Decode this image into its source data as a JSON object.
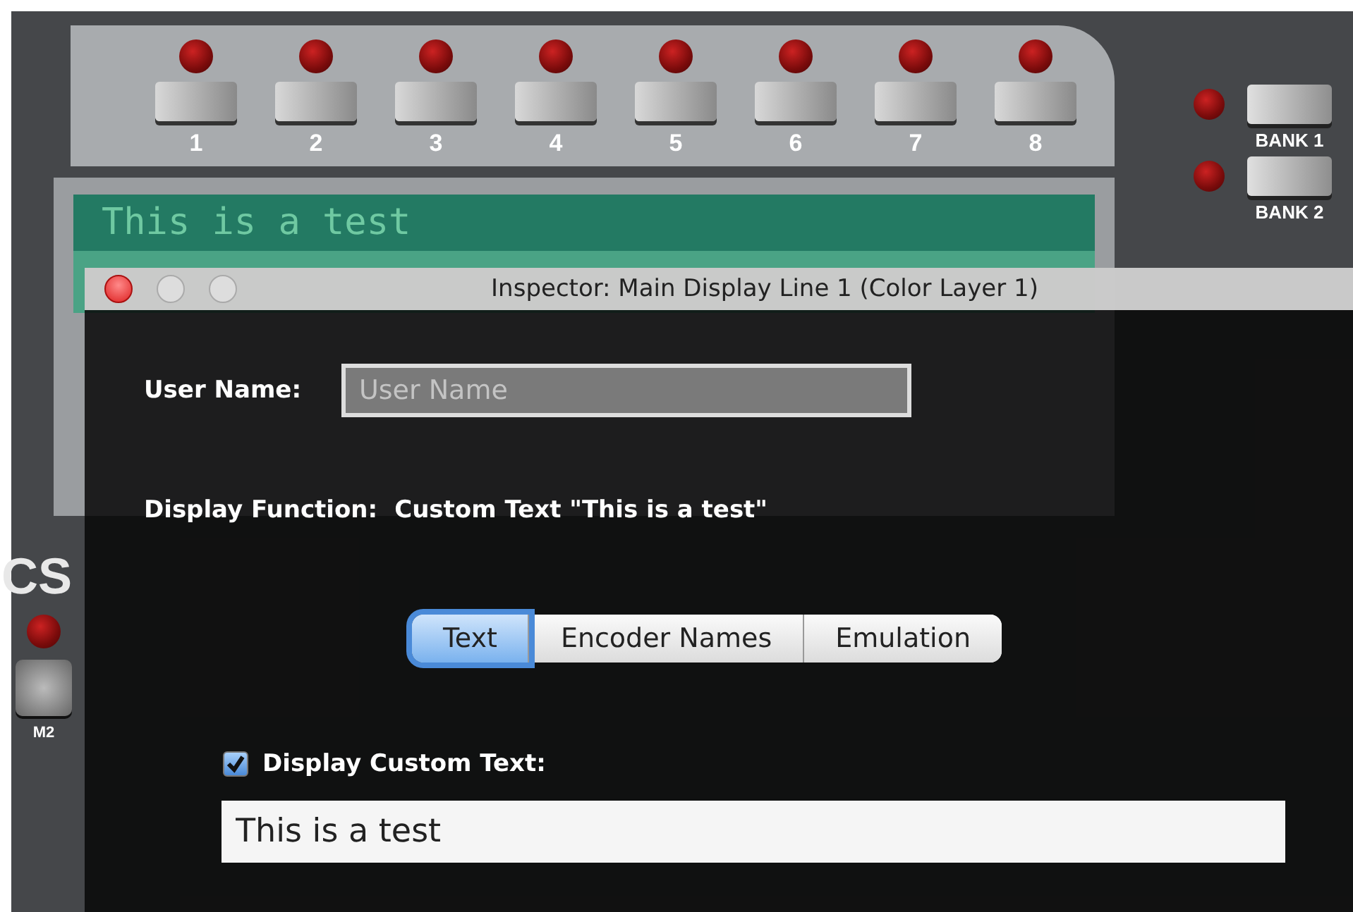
{
  "select_buttons": [
    {
      "label": "1"
    },
    {
      "label": "2"
    },
    {
      "label": "3"
    },
    {
      "label": "4"
    },
    {
      "label": "5"
    },
    {
      "label": "6"
    },
    {
      "label": "7"
    },
    {
      "label": "8"
    }
  ],
  "bank_buttons": [
    {
      "label": "BANK 1"
    },
    {
      "label": "BANK 2"
    }
  ],
  "lcd": {
    "text": "This is a test"
  },
  "logo": "CS",
  "mode_button": {
    "label": "M2"
  },
  "inspector": {
    "title": "Inspector: Main Display Line 1 (Color Layer 1)",
    "user_name": {
      "label": "User Name:",
      "placeholder": "User Name"
    },
    "display_function": {
      "label": "Display Function:",
      "value": "Custom Text \"This is a test\""
    },
    "tabs": [
      {
        "label": "Text",
        "selected": true
      },
      {
        "label": "Encoder Names",
        "selected": false
      },
      {
        "label": "Emulation",
        "selected": false
      }
    ],
    "display_custom_text": {
      "label": "Display Custom Text:",
      "checked": true
    },
    "custom_text": {
      "value": "This is a test"
    }
  }
}
